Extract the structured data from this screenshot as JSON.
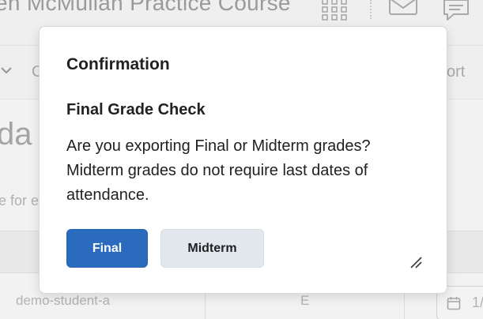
{
  "background": {
    "course_title": "en McMullan Practice Course",
    "nav_left_fragment": "C",
    "nav_right_fragment": "ort",
    "heading_fragment": "da",
    "description_fragment": "e for e",
    "row": {
      "student": "demo-student-a",
      "grade": "E",
      "date_fragment": "1/"
    },
    "icons": [
      "apps-grid-icon",
      "mail-icon",
      "chat-icon",
      "chevron-down-icon",
      "calendar-icon"
    ]
  },
  "dialog": {
    "title": "Confirmation",
    "subtitle": "Final Grade Check",
    "body": "Are you exporting Final or Midterm grades? Midterm grades do not require last dates of attendance.",
    "primary_button": "Final",
    "secondary_button": "Midterm",
    "icons": [
      "resize-handle-icon"
    ]
  },
  "colors": {
    "primary_button": "#2a6bbd",
    "secondary_button": "#e3e8ef",
    "dialog_background": "#ffffff",
    "backdrop": "#f2f2f2"
  }
}
